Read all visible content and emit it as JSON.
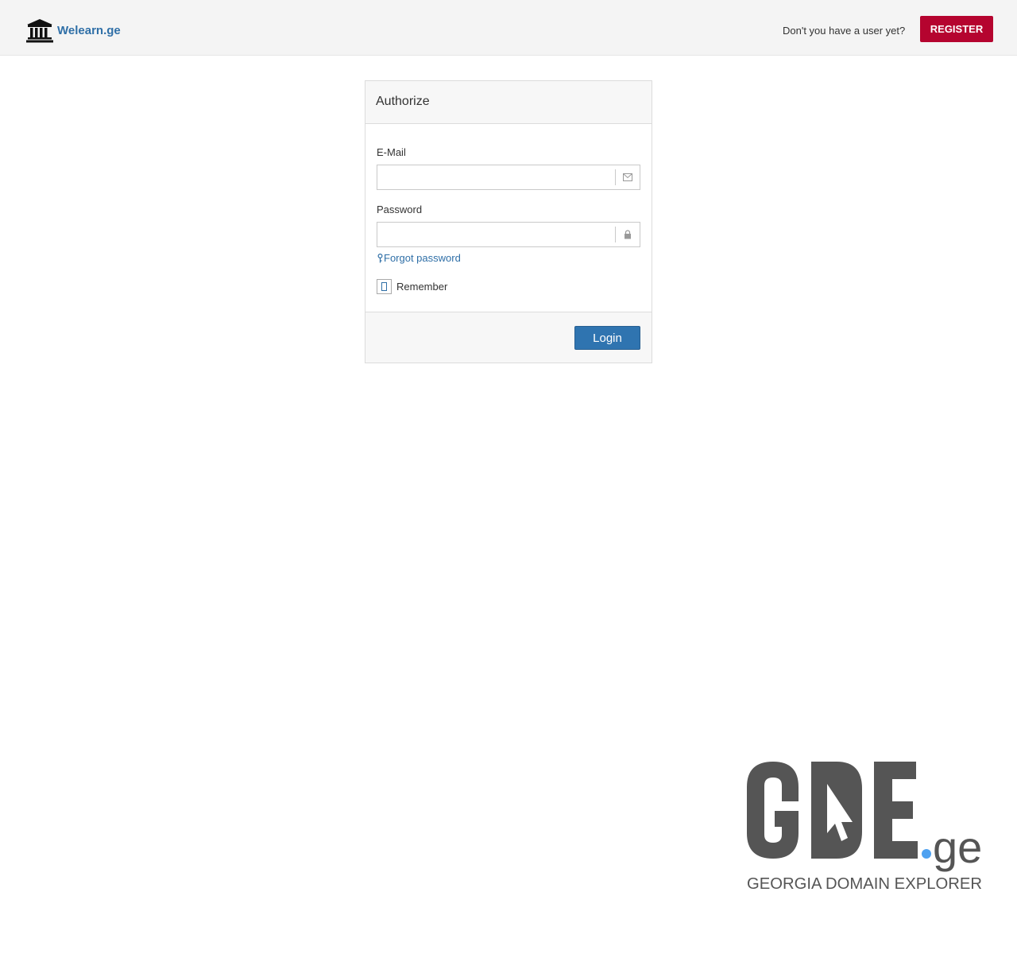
{
  "header": {
    "brand_name": "Welearn.ge",
    "brand_icon": "bank-building-icon",
    "register_prompt": "Don't you have a user yet?",
    "register_label": "REGISTER"
  },
  "login_panel": {
    "title": "Authorize",
    "email_label": "E-Mail",
    "email_value": "",
    "email_icon": "envelope-icon",
    "password_label": "Password",
    "password_value": "",
    "password_icon": "lock-icon",
    "forgot_label": "Forgot password",
    "forgot_icon": "key-icon",
    "remember_label": "Remember",
    "remember_checked": false,
    "login_label": "Login"
  },
  "footer_logo": {
    "wordmark": "GDE",
    "suffix": ".ge",
    "tagline": "GEORGIA DOMAIN EXPLORER"
  },
  "colors": {
    "brand_link": "#2f6fa7",
    "register_button": "#b5042f",
    "login_button": "#2f74b0",
    "logo_gray": "#555555",
    "logo_dot": "#4ea1f0"
  }
}
